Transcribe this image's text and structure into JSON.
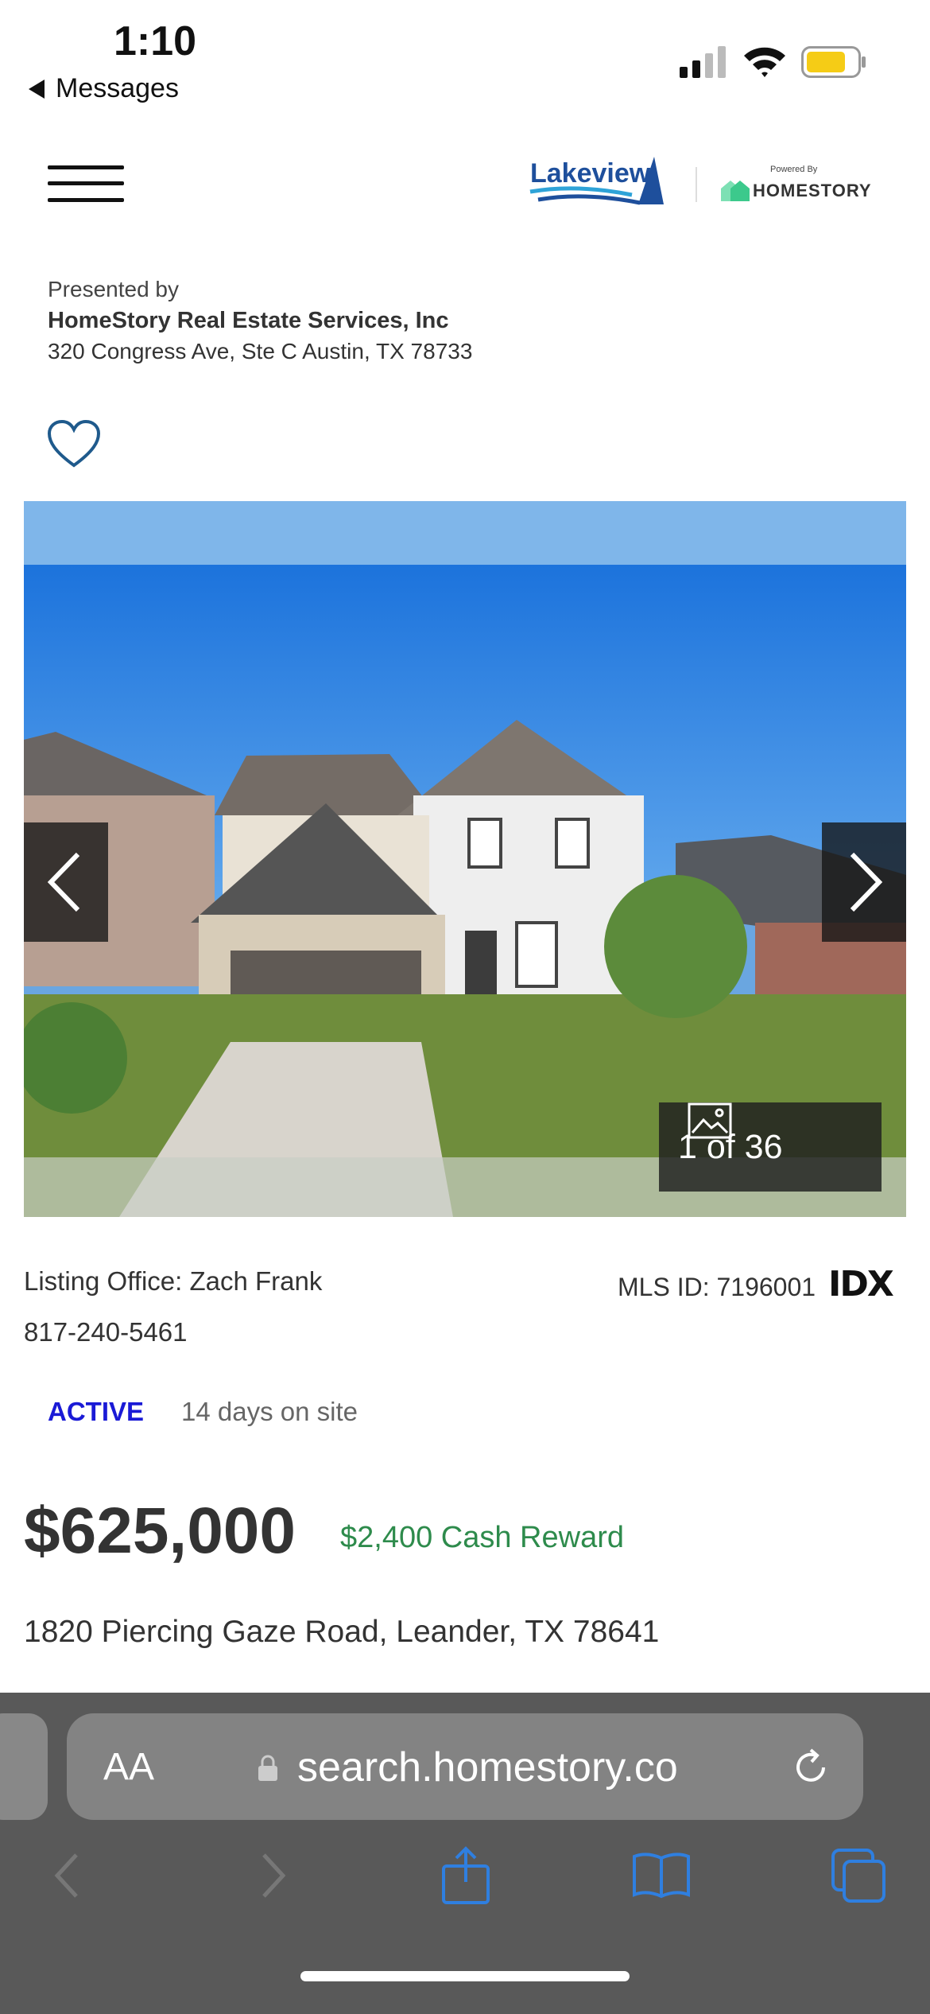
{
  "status_bar": {
    "time": "1:10",
    "back_app": "Messages"
  },
  "header": {
    "brand_primary": "Lakeview",
    "powered_by": "Powered By",
    "brand_secondary": "HOMESTORY"
  },
  "presenter": {
    "presented_by": "Presented by",
    "broker": "HomeStory Real Estate Services, Inc",
    "address": "320 Congress Ave, Ste C Austin, TX 78733"
  },
  "photo": {
    "counter": "1 of 36",
    "current": 1,
    "total": 36
  },
  "listing": {
    "office": "Listing Office: Zach Frank",
    "phone": "817-240-5461",
    "mls": "MLS ID: 7196001",
    "idx_logo": "IDX",
    "status": "ACTIVE",
    "days_on_site": "14 days on site",
    "price": "$625,000",
    "cash_reward": "$2,400 Cash Reward",
    "address": "1820 Piercing Gaze Road, Leander, TX 78641"
  },
  "browser": {
    "text_size_label": "AA",
    "url": "search.homestory.co"
  },
  "colors": {
    "status_active": "#1a1ad6",
    "reward_green": "#2e8b4c",
    "toolbar_blue": "#2f7fe0",
    "lakeview_blue": "#1e4f9c",
    "homestory_green": "#3cc98c"
  },
  "icons": [
    "heart-icon",
    "chevron-left-icon",
    "chevron-right-icon",
    "image-icon",
    "lock-icon",
    "reload-icon",
    "share-icon",
    "bookmarks-icon",
    "tabs-icon"
  ]
}
